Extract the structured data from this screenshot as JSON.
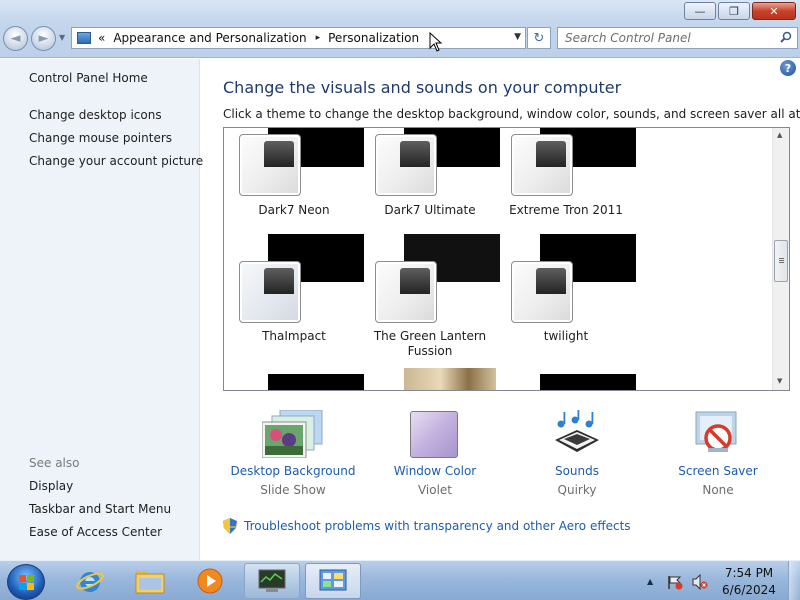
{
  "window": {
    "minimize_glyph": "—",
    "maximize_glyph": "❐",
    "close_glyph": "✕"
  },
  "nav": {
    "back_glyph": "◄",
    "forward_glyph": "►",
    "dropdown_glyph": "▼"
  },
  "address": {
    "overflow": "«",
    "segments": [
      "Appearance and Personalization",
      "Personalization"
    ],
    "separator": "▸",
    "dropdown_glyph": "▼",
    "refresh_glyph": "↻"
  },
  "search": {
    "placeholder": "Search Control Panel"
  },
  "sidebar": {
    "home": "Control Panel Home",
    "links": [
      "Change desktop icons",
      "Change mouse pointers",
      "Change your account picture"
    ],
    "see_also_label": "See also",
    "see_also": [
      "Display",
      "Taskbar and Start Menu",
      "Ease of Access Center"
    ]
  },
  "main": {
    "help_glyph": "?",
    "title": "Change the visuals and sounds on your computer",
    "subtitle": "Click a theme to change the desktop background, window color, sounds, and screen saver all at once.",
    "themes": [
      {
        "name": "Dark7 Neon"
      },
      {
        "name": "Dark7 Ultimate"
      },
      {
        "name": "Extreme Tron 2011"
      },
      {
        "name": "ThaImpact"
      },
      {
        "name": "The Green Lantern Fussion"
      },
      {
        "name": "twilight"
      }
    ],
    "scroll": {
      "up_glyph": "▲",
      "down_glyph": "▼"
    }
  },
  "settings": [
    {
      "label": "Desktop Background",
      "value": "Slide Show",
      "icon": "desktop-background-icon"
    },
    {
      "label": "Window Color",
      "value": "Violet",
      "icon": "window-color-icon"
    },
    {
      "label": "Sounds",
      "value": "Quirky",
      "icon": "sounds-icon"
    },
    {
      "label": "Screen Saver",
      "value": "None",
      "icon": "screen-saver-icon"
    }
  ],
  "troubleshoot": {
    "text": "Troubleshoot problems with transparency and other Aero effects"
  },
  "taskbar": {
    "tray_up_glyph": "▲",
    "time": "7:54 PM",
    "date": "6/6/2024"
  },
  "colors": {
    "link": "#1c5dac",
    "title": "#1e3a6e",
    "window_color_swatch": "#b9a7d8"
  }
}
